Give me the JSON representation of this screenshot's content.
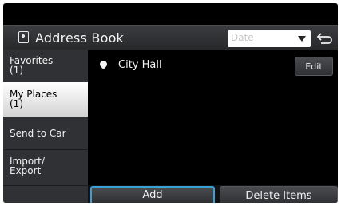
{
  "header": {
    "title": "Address Book",
    "icon": "address-book-icon",
    "sort": {
      "selected": "Date"
    },
    "back_icon": "back-arrow-icon"
  },
  "sidebar": {
    "items": [
      {
        "label": "Favorites",
        "count": "(1)",
        "selected": false
      },
      {
        "label": "My Places",
        "count": "(1)",
        "selected": true
      },
      {
        "label": "Send to Car",
        "selected": false
      },
      {
        "label": "Import/",
        "label2": "Export",
        "selected": false
      }
    ]
  },
  "list": {
    "items": [
      {
        "icon": "location-pin-icon",
        "label": "City Hall",
        "edit_label": "Edit"
      }
    ]
  },
  "actions": {
    "add_label": "Add",
    "delete_label": "Delete Items"
  },
  "colors": {
    "focus_border": "#3aa0d8",
    "background": "#000000",
    "sidebar": "#2f3134"
  }
}
